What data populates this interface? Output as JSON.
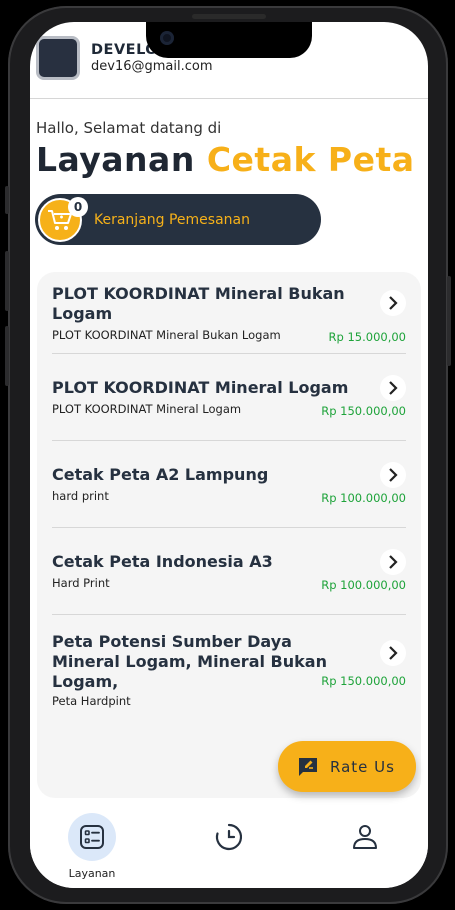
{
  "profile": {
    "name": "DEVELO",
    "email": "dev16@gmail.com"
  },
  "greeting": "Hallo, Selamat datang di",
  "title": {
    "part1": "Layanan",
    "part2": "Cetak Peta"
  },
  "cart": {
    "count": "0",
    "label": "Keranjang Pemesanan"
  },
  "items": [
    {
      "title": "PLOT KOORDINAT Mineral Bukan Logam",
      "subtitle": "PLOT KOORDINAT Mineral Bukan Logam",
      "price": "Rp 15.000,00"
    },
    {
      "title": "PLOT KOORDINAT  Mineral Logam",
      "subtitle": "PLOT KOORDINAT  Mineral Logam",
      "price": "Rp 150.000,00"
    },
    {
      "title": "Cetak Peta A2 Lampung",
      "subtitle": "hard print",
      "price": "Rp 100.000,00"
    },
    {
      "title": "Cetak Peta Indonesia A3",
      "subtitle": "Hard Print",
      "price": "Rp 100.000,00"
    },
    {
      "title": "Peta Potensi Sumber Daya Mineral Logam, Mineral Bukan Logam,",
      "subtitle": "Peta Hardpint",
      "price": "Rp 150.000,00"
    }
  ],
  "rate_button": {
    "label": "Rate Us"
  },
  "nav": {
    "items": [
      {
        "label": "Layanan",
        "icon": "list-icon"
      },
      {
        "label": "",
        "icon": "history-icon"
      },
      {
        "label": "",
        "icon": "profile-icon"
      }
    ]
  },
  "colors": {
    "accent": "#f7b019",
    "dark": "#263140",
    "price": "#1ea33a",
    "nav_active": "#dbe8f9"
  }
}
